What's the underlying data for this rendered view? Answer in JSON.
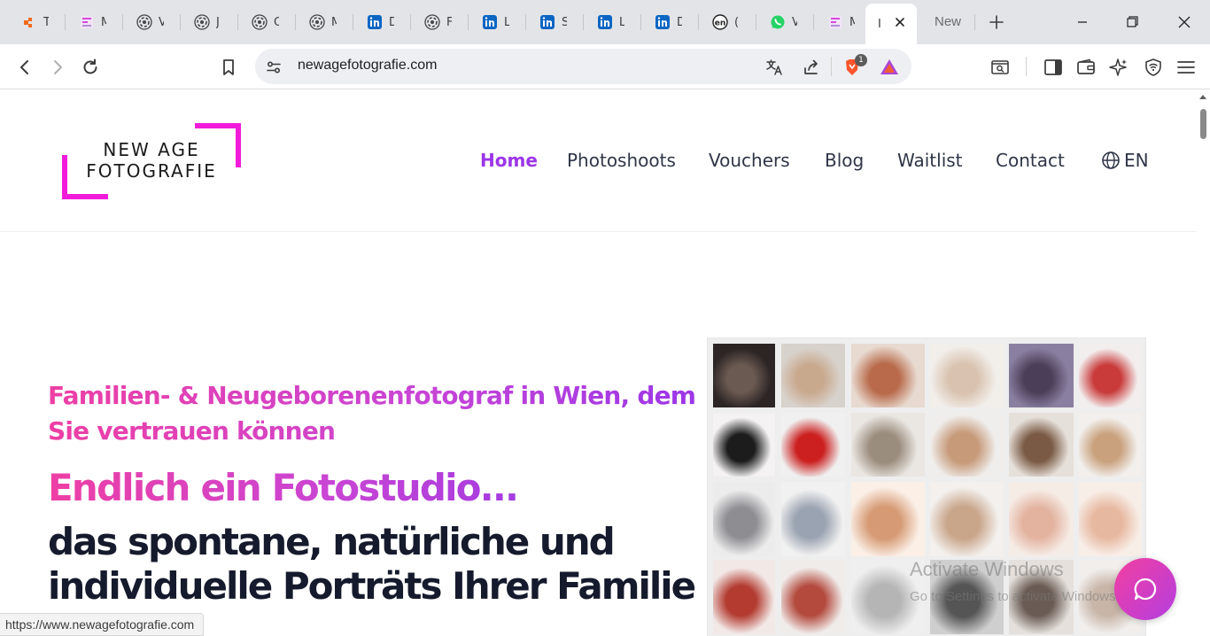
{
  "browser": {
    "tabs": [
      {
        "title": "T",
        "icon": "orange-cube-icon"
      },
      {
        "title": "M",
        "icon": "pink-site-icon"
      },
      {
        "title": "V",
        "icon": "openai-icon"
      },
      {
        "title": "J",
        "icon": "openai-icon"
      },
      {
        "title": "C",
        "icon": "openai-icon"
      },
      {
        "title": "M",
        "icon": "openai-icon"
      },
      {
        "title": "D",
        "icon": "linkedin-icon"
      },
      {
        "title": "F",
        "icon": "openai-icon"
      },
      {
        "title": "L",
        "icon": "linkedin-icon"
      },
      {
        "title": "S",
        "icon": "linkedin-icon"
      },
      {
        "title": "L",
        "icon": "linkedin-icon"
      },
      {
        "title": "D",
        "icon": "linkedin-icon"
      },
      {
        "title": "(",
        "icon": "en-icon"
      },
      {
        "title": "V",
        "icon": "whatsapp-icon"
      },
      {
        "title": "M",
        "icon": "pink-site-icon"
      },
      {
        "title": "I",
        "icon": "none"
      }
    ],
    "new_tab_label": "New",
    "url": "newagefotografie.com",
    "brave_badge": "1",
    "status_url": "https://www.newagefotografie.com"
  },
  "site": {
    "logo": {
      "line1": "NEW AGE",
      "line2": "FOTOGRAFIE"
    },
    "nav": {
      "home": "Home",
      "photoshoots": "Photoshoots",
      "vouchers": "Vouchers",
      "blog": "Blog",
      "waitlist": "Waitlist",
      "contact": "Contact",
      "language": "EN"
    },
    "hero": {
      "eyebrow": "Familien- & Neugeborenenfotograf in Wien, dem Sie vertrauen können",
      "headline_a": "Endlich ein Fotostudio...",
      "headline_b": "das spontane, natürliche und individuelle Porträts Ihrer Familie"
    }
  },
  "os": {
    "activate_title": "Activate Windows",
    "activate_sub": "Go to Settings to activate Windows."
  },
  "colors": {
    "accent_purple": "#9b36e8",
    "accent_pink": "#ee3fa4",
    "logo_magenta": "#f21bd9",
    "dark_text": "#151a2c"
  }
}
